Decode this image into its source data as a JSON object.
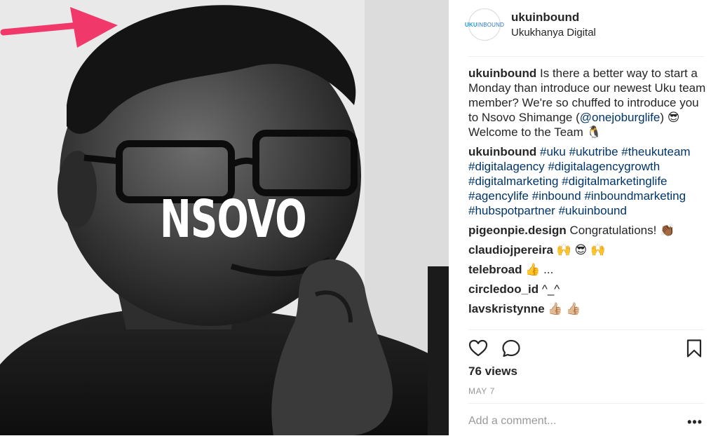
{
  "media": {
    "overlay_text": "NSOVO",
    "accent_arrow_color": "#f0386b"
  },
  "post": {
    "username": "ukuinbound",
    "location": "Ukukhanya Digital",
    "avatar_logo_prefix": "UKU",
    "avatar_logo_suffix": "INBOUND"
  },
  "caption": {
    "user": "ukuinbound",
    "text_1": "Is there a better way to start a Monday than introduce our newest Uku team member? We're so chuffed to introduce you to Nsovo Shimange (",
    "mention": "@onejoburglife",
    "text_2": ") 😎 Welcome to the Team 🐧"
  },
  "hashtags_comment": {
    "user": "ukuinbound",
    "tags": [
      "#uku",
      "#ukutribe",
      "#theukuteam",
      "#digitalagency",
      "#digitalagencygrowth",
      "#digitalmarketing",
      "#digitalmarketinglife",
      "#agencylife",
      "#inbound",
      "#inboundmarketing",
      "#hubspotpartner",
      "#ukuinbound"
    ]
  },
  "comments": [
    {
      "user": "pigeonpie.design",
      "text": "Congratulations! 👏🏾"
    },
    {
      "user": "claudiojpereira",
      "text": "🙌 😎 🙌"
    },
    {
      "user": "telebroad",
      "text": "👍 ..."
    },
    {
      "user": "circledoo_id",
      "text": "^_^"
    },
    {
      "user": "lavskristynne",
      "text": "👍🏼 👍🏼"
    }
  ],
  "actions": {
    "like_icon": "heart-icon",
    "comment_icon": "comment-bubble-icon",
    "save_icon": "bookmark-icon"
  },
  "stats": {
    "views": "76 views",
    "date": "MAY 7"
  },
  "add_comment": {
    "placeholder": "Add a comment...",
    "more_label": "•••"
  }
}
